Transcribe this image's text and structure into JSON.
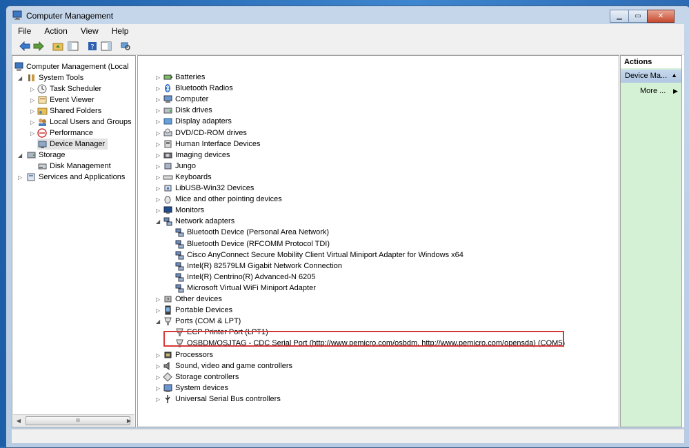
{
  "window": {
    "title": "Computer Management"
  },
  "menu": [
    "File",
    "Action",
    "View",
    "Help"
  ],
  "left_tree": {
    "root": "Computer Management (Local",
    "system_tools": "System Tools",
    "task_scheduler": "Task Scheduler",
    "event_viewer": "Event Viewer",
    "shared_folders": "Shared Folders",
    "local_users": "Local Users and Groups",
    "performance": "Performance",
    "device_manager": "Device Manager",
    "storage": "Storage",
    "disk_management": "Disk Management",
    "services": "Services and Applications",
    "scroll_glyph": "III"
  },
  "devices": [
    {
      "label": "Batteries",
      "icon": "battery-icon",
      "level": 0,
      "expanded": false
    },
    {
      "label": "Bluetooth Radios",
      "icon": "bluetooth-icon",
      "level": 0,
      "expanded": false
    },
    {
      "label": "Computer",
      "icon": "computer-icon",
      "level": 0,
      "expanded": false
    },
    {
      "label": "Disk drives",
      "icon": "disk-icon",
      "level": 0,
      "expanded": false
    },
    {
      "label": "Display adapters",
      "icon": "display-icon",
      "level": 0,
      "expanded": false
    },
    {
      "label": "DVD/CD-ROM drives",
      "icon": "dvd-icon",
      "level": 0,
      "expanded": false
    },
    {
      "label": "Human Interface Devices",
      "icon": "hid-icon",
      "level": 0,
      "expanded": false
    },
    {
      "label": "Imaging devices",
      "icon": "camera-icon",
      "level": 0,
      "expanded": false
    },
    {
      "label": "Jungo",
      "icon": "device-icon",
      "level": 0,
      "expanded": false
    },
    {
      "label": "Keyboards",
      "icon": "keyboard-icon",
      "level": 0,
      "expanded": false
    },
    {
      "label": "LibUSB-Win32 Devices",
      "icon": "usb-device-icon",
      "level": 0,
      "expanded": false
    },
    {
      "label": "Mice and other pointing devices",
      "icon": "mouse-icon",
      "level": 0,
      "expanded": false
    },
    {
      "label": "Monitors",
      "icon": "monitor-icon",
      "level": 0,
      "expanded": false
    },
    {
      "label": "Network adapters",
      "icon": "network-icon",
      "level": 0,
      "expanded": true
    },
    {
      "label": "Bluetooth Device (Personal Area Network)",
      "icon": "network-icon",
      "level": 1
    },
    {
      "label": "Bluetooth Device (RFCOMM Protocol TDI)",
      "icon": "network-icon",
      "level": 1
    },
    {
      "label": "Cisco AnyConnect Secure Mobility Client Virtual Miniport Adapter for Windows x64",
      "icon": "network-icon",
      "level": 1
    },
    {
      "label": "Intel(R) 82579LM Gigabit Network Connection",
      "icon": "network-icon",
      "level": 1
    },
    {
      "label": "Intel(R) Centrino(R) Advanced-N 6205",
      "icon": "network-icon",
      "level": 1
    },
    {
      "label": "Microsoft Virtual WiFi Miniport Adapter",
      "icon": "network-icon",
      "level": 1
    },
    {
      "label": "Other devices",
      "icon": "unknown-device-icon",
      "level": 0,
      "expanded": false
    },
    {
      "label": "Portable Devices",
      "icon": "portable-device-icon",
      "level": 0,
      "expanded": false
    },
    {
      "label": "Ports (COM & LPT)",
      "icon": "port-icon",
      "level": 0,
      "expanded": true
    },
    {
      "label": "ECP Printer Port (LPT1)",
      "icon": "port-icon",
      "level": 1
    },
    {
      "label": "OSBDM/OSJTAG - CDC Serial Port (http://www.pemicro.com/osbdm, http://www.pemicro.com/opensda) (COM5)",
      "icon": "port-icon",
      "level": 1
    },
    {
      "label": "Processors",
      "icon": "processor-icon",
      "level": 0,
      "expanded": false
    },
    {
      "label": "Sound, video and game controllers",
      "icon": "sound-icon",
      "level": 0,
      "expanded": false
    },
    {
      "label": "Storage controllers",
      "icon": "storage-controller-icon",
      "level": 0,
      "expanded": false
    },
    {
      "label": "System devices",
      "icon": "system-device-icon",
      "level": 0,
      "expanded": false
    },
    {
      "label": "Universal Serial Bus controllers",
      "icon": "usb-icon",
      "level": 0,
      "expanded": false
    }
  ],
  "actions": {
    "title": "Actions",
    "section": "Device Ma...",
    "more": "More ..."
  },
  "colors": {
    "highlight_border": "#d63838",
    "actions_bg": "#d5f1d5"
  }
}
